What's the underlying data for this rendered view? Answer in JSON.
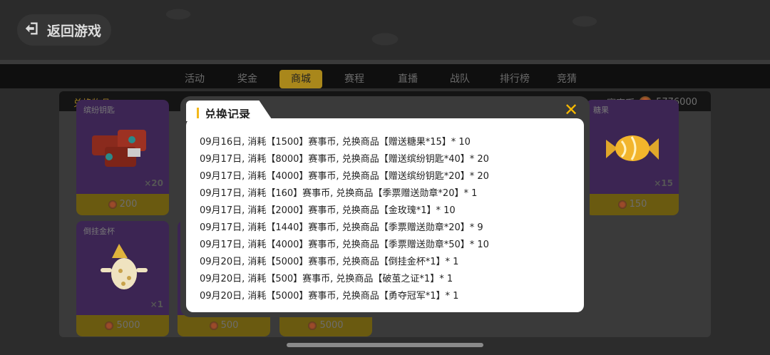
{
  "header": {
    "back_label": "返回游戏"
  },
  "tabs": [
    {
      "label": "活动",
      "active": false
    },
    {
      "label": "奖金",
      "active": false
    },
    {
      "label": "商城",
      "active": true
    },
    {
      "label": "赛程",
      "active": false
    },
    {
      "label": "直播",
      "active": false
    },
    {
      "label": "战队",
      "active": false
    },
    {
      "label": "排行榜",
      "active": false
    },
    {
      "label": "竞猜",
      "active": false
    }
  ],
  "shop": {
    "title": "兑换物品",
    "currency_label": "赛事币",
    "currency_amount": "5776000",
    "cards": [
      {
        "name": "缤纷钥匙",
        "qty": "×20",
        "price": "200",
        "icon": "gift-boxes-icon"
      },
      {
        "name": "糖果",
        "qty": "×15",
        "price": "150",
        "icon": "candy-icon"
      },
      {
        "name": "倒挂金杯",
        "qty": "×1",
        "price": "5000",
        "icon": "jester-cup-icon"
      },
      {
        "name": "",
        "qty": "",
        "price": "500",
        "icon": ""
      },
      {
        "name": "",
        "qty": "",
        "price": "5000",
        "icon": ""
      }
    ]
  },
  "modal": {
    "title": "兑换记录",
    "records": [
      "09月16日, 消耗【1500】赛事币, 兑换商品【赠送糖果*15】* 10",
      "09月17日, 消耗【8000】赛事币, 兑换商品【赠送缤纷钥匙*40】* 20",
      "09月17日, 消耗【4000】赛事币, 兑换商品【赠送缤纷钥匙*20】* 20",
      "09月17日, 消耗【160】赛事币, 兑换商品【季票赠送勋章*20】* 1",
      "09月17日, 消耗【2000】赛事币, 兑换商品【金玫瑰*1】* 10",
      "09月17日, 消耗【1440】赛事币, 兑换商品【季票赠送勋章*20】* 9",
      "09月17日, 消耗【4000】赛事币, 兑换商品【季票赠送勋章*50】* 10",
      "09月20日, 消耗【5000】赛事币, 兑换商品【倒挂金杯*1】* 1",
      "09月20日, 消耗【500】赛事币, 兑换商品【破茧之证*1】* 1",
      "09月20日, 消耗【5000】赛事币, 兑换商品【勇夺冠军*1】* 1"
    ]
  }
}
